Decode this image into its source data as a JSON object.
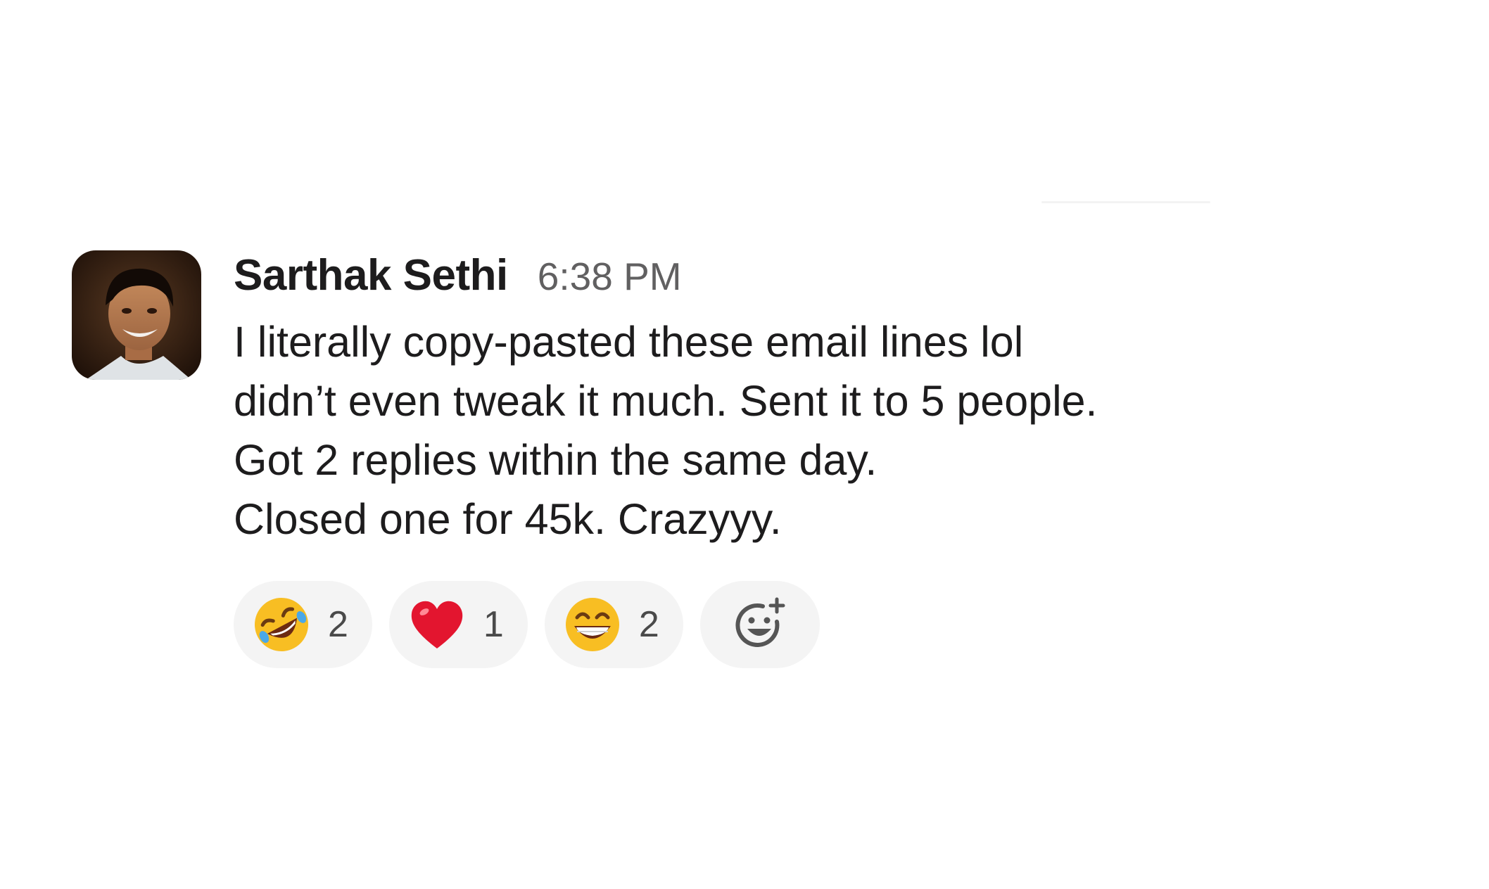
{
  "message": {
    "author": "Sarthak Sethi",
    "timestamp": "6:38 PM",
    "lines": [
      "I literally copy-pasted these email lines lol",
      "didn’t even tweak it much. Sent it to 5 people.",
      "Got 2 replies within the same day.",
      "Closed one for 45k. Crazyyy."
    ]
  },
  "reactions": [
    {
      "icon": "rofl-emoji-icon",
      "count": "2"
    },
    {
      "icon": "red-heart-emoji-icon",
      "count": "1"
    },
    {
      "icon": "grinning-emoji-icon",
      "count": "2"
    }
  ],
  "add_reaction": {
    "icon": "add-reaction-icon"
  },
  "colors": {
    "author": "#1d1c1d",
    "timestamp": "#616061",
    "reaction_bg": "#f4f4f4",
    "heart": "#e3152f",
    "emoji_yellow": "#f8be23"
  }
}
